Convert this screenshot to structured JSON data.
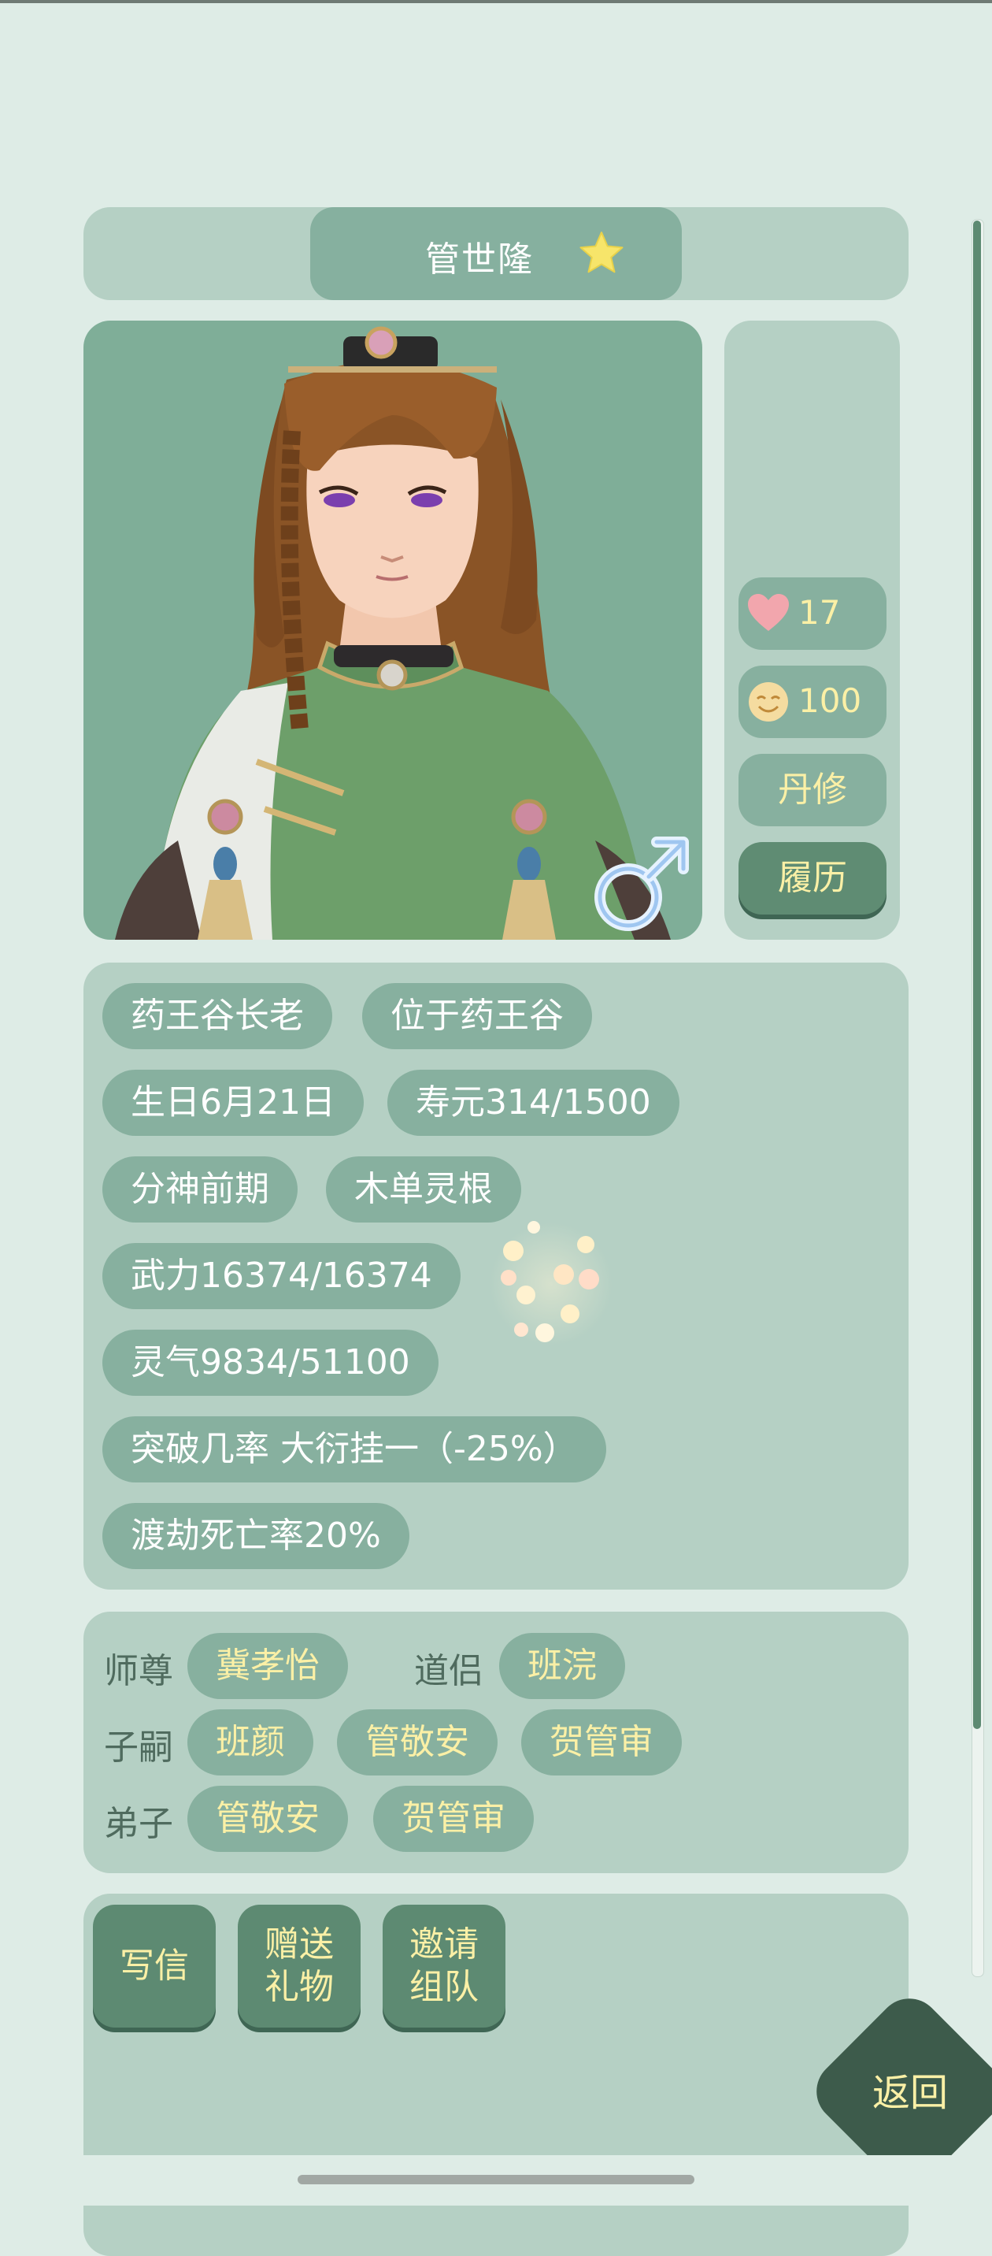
{
  "character": {
    "name": "管世隆",
    "gender": "male",
    "favorite_icon": "star-icon"
  },
  "stats": {
    "affection": "17",
    "mood": "100",
    "profession_button": "丹修",
    "history_button": "履历"
  },
  "info_tags": {
    "title": "药王谷长老",
    "location": "位于药王谷",
    "birthday": "生日6月21日",
    "lifespan": "寿元314/1500",
    "realm": "分神前期",
    "spirit_root": "木单灵根",
    "power": "武力16374/16374",
    "spirit_energy": "灵气9834/51100",
    "breakthrough": "突破几率 大衍挂一（-25%）",
    "tribulation": "渡劫死亡率20%"
  },
  "relations": {
    "master_label": "师尊",
    "master": "冀孝怡",
    "partner_label": "道侣",
    "partner": "班浣",
    "children_label": "子嗣",
    "children": [
      "班颜",
      "管敬安",
      "贺管审"
    ],
    "disciples_label": "弟子",
    "disciples": [
      "管敬安",
      "贺管审"
    ]
  },
  "actions": {
    "write_letter": "写信",
    "gift_line1": "赠送",
    "gift_line2": "礼物",
    "invite_line1": "邀请",
    "invite_line2": "组队",
    "back": "返回"
  },
  "colors": {
    "background": "#deece6",
    "panel": "#b5d0c4",
    "pill": "#87b09f",
    "button_dark": "#5d8a72",
    "accent_text": "#fbf0a6",
    "back_button": "#3d5b4b"
  }
}
